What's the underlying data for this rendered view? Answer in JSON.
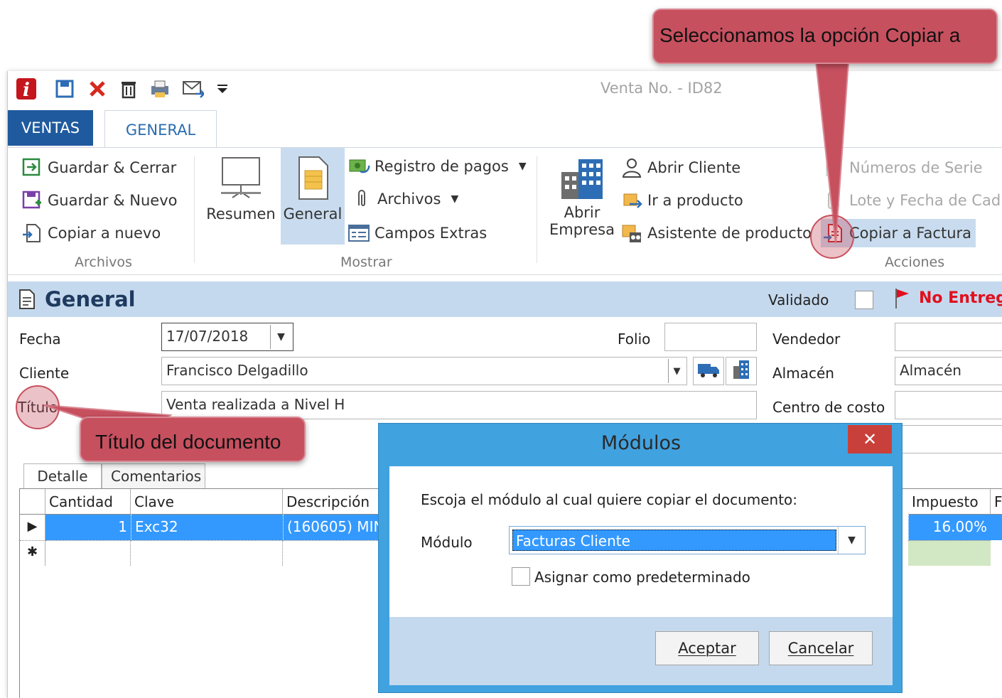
{
  "callouts": {
    "top": "Seleccionamos la opción Copiar a",
    "left": "Título del documento"
  },
  "window": {
    "title": "Venta No. - ID82"
  },
  "qat": {
    "icons": [
      "app-logo-icon",
      "save-icon",
      "delete-x-icon",
      "trash-icon",
      "print-icon",
      "email-icon",
      "dropdown-arrow-icon"
    ]
  },
  "tabs": {
    "ventas": "VENTAS",
    "general": "GENERAL"
  },
  "ribbon": {
    "archivos": {
      "guardar_cerrar": "Guardar & Cerrar",
      "guardar_nuevo": "Guardar & Nuevo",
      "copiar_nuevo": "Copiar a nuevo",
      "label": "Archivos"
    },
    "mostrar": {
      "resumen": "Resumen",
      "general": "General",
      "registro_pagos": "Registro de pagos",
      "archivos": "Archivos",
      "campos_extras": "Campos Extras",
      "label": "Mostrar"
    },
    "empresa": {
      "abrir_line1": "Abrir",
      "abrir_line2": "Empresa"
    },
    "acciones": {
      "abrir_cliente": "Abrir Cliente",
      "ir_producto": "Ir a producto",
      "asistente": "Asistente de producto",
      "numeros_serie": "Números de Serie",
      "lote_fecha": "Lote y Fecha de Cad",
      "copiar_factura": "Copiar a Factura",
      "label": "Acciones"
    }
  },
  "general": {
    "title": "General",
    "validado_label": "Validado",
    "status": "No Entreg",
    "fecha_label": "Fecha",
    "fecha_value": "17/07/2018",
    "folio_label": "Folio",
    "folio_value": "",
    "vendedor_label": "Vendedor",
    "vendedor_value": "",
    "cliente_label": "Cliente",
    "cliente_value": "Francisco Delgadillo",
    "almacen_label": "Almacén",
    "almacen_value": "Almacén",
    "titulo_label": "Título",
    "titulo_value": "Venta realizada a Nivel H",
    "centro_costo_label": "Centro de costo"
  },
  "detail_tabs": {
    "detalle": "Detalle",
    "comentarios": "Comentarios"
  },
  "grid": {
    "headers": [
      "Cantidad",
      "Clave",
      "Descripción",
      "Impuesto",
      "F"
    ],
    "row": {
      "cantidad": "1",
      "clave": "Exc32",
      "descripcion": "(160605) MIN",
      "impuesto": "16.00%"
    },
    "new_row_marker": "✱",
    "current_row_marker": "▶"
  },
  "dialog": {
    "title": "Módulos",
    "prompt": "Escoja el módulo al cual quiere copiar el documento:",
    "module_label": "Módulo",
    "module_value": "Facturas Cliente",
    "default_checkbox": "Asignar como predeterminado",
    "accept": "Aceptar",
    "cancel": "Cancelar",
    "close": "✕"
  },
  "colors": {
    "accent_blue": "#1f5a9e",
    "band": "#c5d9ee",
    "callout": "#c7505f",
    "dialog_frame": "#41a2e0",
    "status_red": "#e0101f",
    "selection": "#3399ff"
  }
}
